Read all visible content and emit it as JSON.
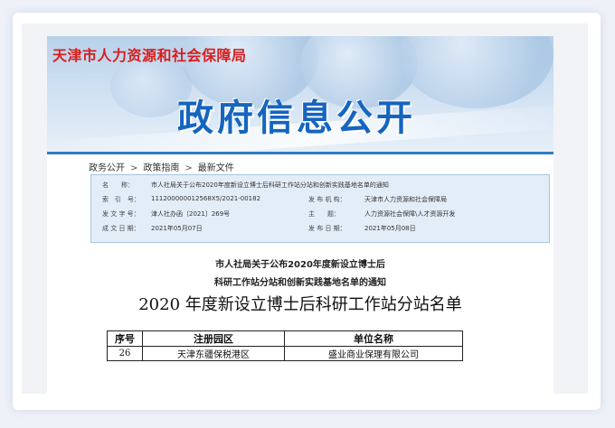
{
  "banner": {
    "agency": "天津市人力资源和社会保障局",
    "headline": "政府信息公开"
  },
  "breadcrumb": [
    "政务公开",
    "政策指南",
    "最新文件"
  ],
  "meta": {
    "name_label": "名　　称：",
    "name_value": "市人社局关于公布2020年度新设立博士后科研工作站分站和创新实践基地名单的通知",
    "index_label": "索　引　号：",
    "index_value": "111200000012568X5/2021-00182",
    "publisher_label": "发 布 机 构：",
    "publisher_value": "天津市人力资源和社会保障局",
    "doc_no_label": "发 文 字 号：",
    "doc_no_value": "津人社办函〔2021〕269号",
    "topic_label": "主　　题：",
    "topic_value": "人力资源社会保障\\人才资源开发",
    "written_label": "成 文 日 期：",
    "written_value": "2021年05月07日",
    "published_label": "发 布 日 期：",
    "published_value": "2021年05月08日"
  },
  "doc": {
    "title_line1": "市人社局关于公布2020年度新设立博士后",
    "title_line2": "科研工作站分站和创新实践基地名单的通知",
    "list_title": "2020 年度新设立博士后科研工作站分站名单"
  },
  "table": {
    "headers": [
      "序号",
      "注册园区",
      "单位名称"
    ],
    "rows": [
      [
        "26",
        "天津东疆保税港区",
        "盛业商业保理有限公司"
      ]
    ]
  }
}
